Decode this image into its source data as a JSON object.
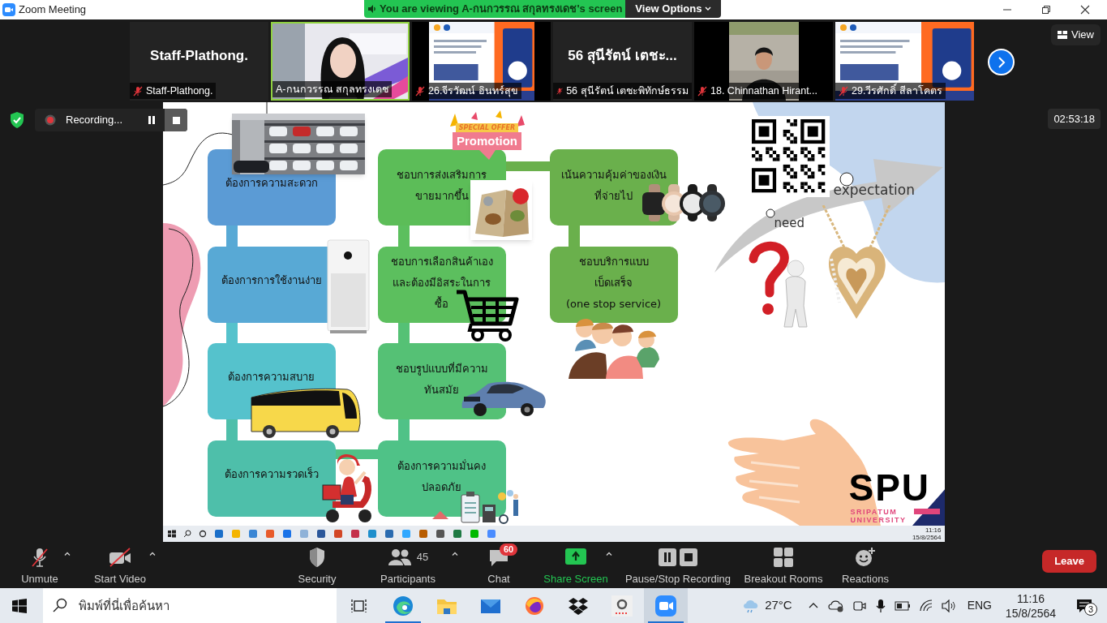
{
  "window": {
    "title": "Zoom Meeting"
  },
  "share_banner": {
    "text": "You are viewing A-กนกวรรณ สกุลทรงเดช's screen",
    "button": "View Options"
  },
  "thumbnails": [
    {
      "kind": "name",
      "big_name": "Staff-Plathong.",
      "name": "Staff-Plathong.",
      "muted": true,
      "speaking": false
    },
    {
      "kind": "video",
      "name": "A-กนกวรรณ สกุลทรงเดช",
      "muted": false,
      "speaking": true
    },
    {
      "kind": "narrow_video",
      "name": "26.จีรวัฒน์ อินทร์สุข",
      "muted": true,
      "speaking": false
    },
    {
      "kind": "name",
      "big_name": "56 สุนีรัตน์ เตชะ...",
      "name": "56 สุนีรัตน์ เตชะพิทักษ์ธรรม",
      "muted": true,
      "speaking": false
    },
    {
      "kind": "narrow_video",
      "name": "18. Chinnathan Hirant...",
      "muted": true,
      "speaking": false
    },
    {
      "kind": "video",
      "name": "29.วีรศักดิ์ สีลาโคตร",
      "muted": true,
      "speaking": false
    }
  ],
  "view_button": "View",
  "recording": {
    "label": "Recording..."
  },
  "timer": "02:53:18",
  "slide": {
    "promotion": {
      "ribbon": "SPECIAL OFFER",
      "label": "Promotion"
    },
    "columns": [
      [
        {
          "lines": [
            "ต้องการความสะดวก"
          ],
          "color": "#5b9bd5"
        },
        {
          "lines": [
            "ต้องการการใช้งานง่าย"
          ],
          "color": "#58a9d5"
        },
        {
          "lines": [
            "ต้องการความสบาย"
          ],
          "color": "#55c2cc"
        },
        {
          "lines": [
            "ต้องการความรวดเร็ว"
          ],
          "color": "#4ebfaa"
        }
      ],
      [
        {
          "lines": [
            "ชอบการส่งเสริมการ",
            "ขายมากขึ้น"
          ],
          "color": "#5cbd58"
        },
        {
          "lines": [
            "ชอบการเลือกสินค้าเอง",
            "และต้องมีอิสระในการ",
            "ซื้อ"
          ],
          "color": "#5cbf5e"
        },
        {
          "lines": [
            "ชอบรูปแบบที่มีความ",
            "ทันสมัย"
          ],
          "color": "#55c175"
        },
        {
          "lines": [
            "ต้องการความมั่นคง",
            "ปลอดภัย"
          ],
          "color": "#4fc287"
        }
      ],
      [
        {
          "lines": [
            "เน้นความคุ้มค่าของเงิน",
            "ที่จ่ายไป"
          ],
          "color": "#6ab04c"
        },
        {
          "lines": [
            "ชอบบริการแบบ",
            "เบ็ดเสร็จ",
            "(one stop service)"
          ],
          "color": "#6ab04c"
        }
      ]
    ],
    "expectation": "expectation",
    "need": "need",
    "logo": {
      "name": "SPU",
      "line_1": "SRIPATUM",
      "line_2": "UNIVERSITY"
    },
    "taskbar": {
      "time": "11:16",
      "date": "15/8/2564"
    }
  },
  "toolbar": [
    {
      "kind": "mic",
      "label": "Unmute",
      "caret": true
    },
    {
      "kind": "video",
      "label": "Start Video",
      "caret": true
    },
    {
      "kind": "security",
      "label": "Security",
      "caret": false
    },
    {
      "kind": "participants",
      "label": "Participants",
      "count": "45",
      "caret": true
    },
    {
      "kind": "chat",
      "label": "Chat",
      "badge": "60",
      "caret": false
    },
    {
      "kind": "share",
      "label": "Share Screen",
      "caret": true
    },
    {
      "kind": "recording",
      "label": "Pause/Stop Recording",
      "caret": false
    },
    {
      "kind": "breakout",
      "label": "Breakout Rooms",
      "caret": false
    },
    {
      "kind": "reactions",
      "label": "Reactions",
      "caret": false
    }
  ],
  "leave_button": "Leave",
  "taskbar": {
    "search_placeholder": "พิมพ์ที่นี่เพื่อค้นหา",
    "apps": [
      {
        "kind": "taskview",
        "running": false,
        "focused": false
      },
      {
        "kind": "edge",
        "running": true,
        "focused": false
      },
      {
        "kind": "explorer",
        "running": false,
        "focused": false
      },
      {
        "kind": "mail",
        "running": false,
        "focused": false
      },
      {
        "kind": "firefox",
        "running": false,
        "focused": false
      },
      {
        "kind": "dropbox",
        "running": false,
        "focused": false
      },
      {
        "kind": "amazon",
        "running": false,
        "focused": false
      },
      {
        "kind": "zoom",
        "running": true,
        "focused": true
      }
    ],
    "temperature": "27°C",
    "language": "ENG",
    "time": "11:16",
    "date": "15/8/2564",
    "notifications": "3"
  }
}
